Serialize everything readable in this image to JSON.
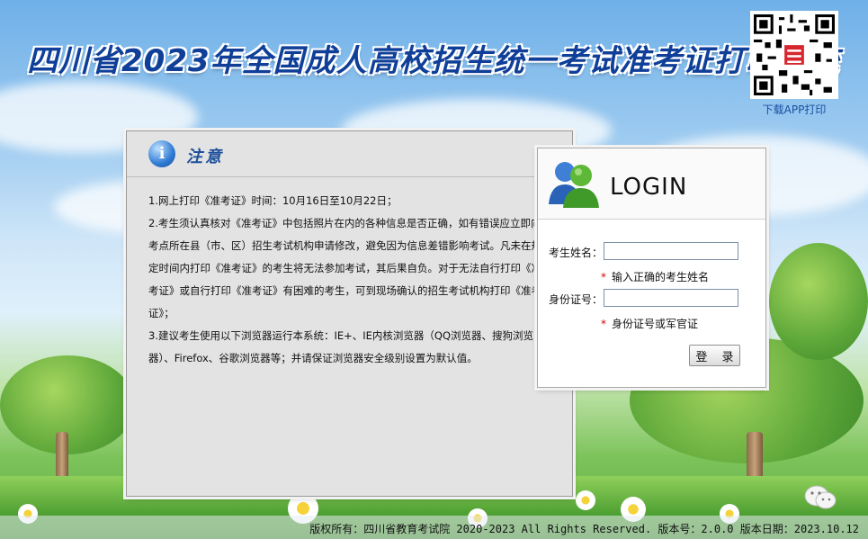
{
  "header": {
    "title": "四川省2023年全国成人高校招生统一考试准考证打印系统",
    "qr_caption": "下载APP打印"
  },
  "notice": {
    "title": "注意",
    "items": [
      "1.网上打印《准考证》时间：10月16日至10月22日；",
      "2.考生须认真核对《准考证》中包括照片在内的各种信息是否正确，如有错误应立即向考点所在县（市、区）招生考试机构申请修改，避免因为信息差错影响考试。凡未在规定时间内打印《准考证》的考生将无法参加考试，其后果自负。对于无法自行打印《准考证》或自行打印《准考证》有困难的考生，可到现场确认的招生考试机构打印《准考证》；",
      "3.建议考生使用以下浏览器运行本系统：IE+、IE内核浏览器（QQ浏览器、搜狗浏览器）、Firefox、谷歌浏览器等；并请保证浏览器安全级别设置为默认值。"
    ]
  },
  "login": {
    "title": "LOGIN",
    "name_label": "考生姓名：",
    "name_value": "",
    "name_hint": "输入正确的考生姓名",
    "id_label": "身份证号：",
    "id_value": "",
    "id_hint": "身份证号或军官证",
    "submit_label": "登 录"
  },
  "footer": {
    "text": "版权所有：四川省教育考试院 2020-2023 All Rights Reserved. 版本号：2.0.0 版本日期：2023.10.12"
  },
  "colors": {
    "title": "#0f3f98",
    "accent_red": "#dd0000",
    "notice_bg": "#e3e3e3"
  }
}
